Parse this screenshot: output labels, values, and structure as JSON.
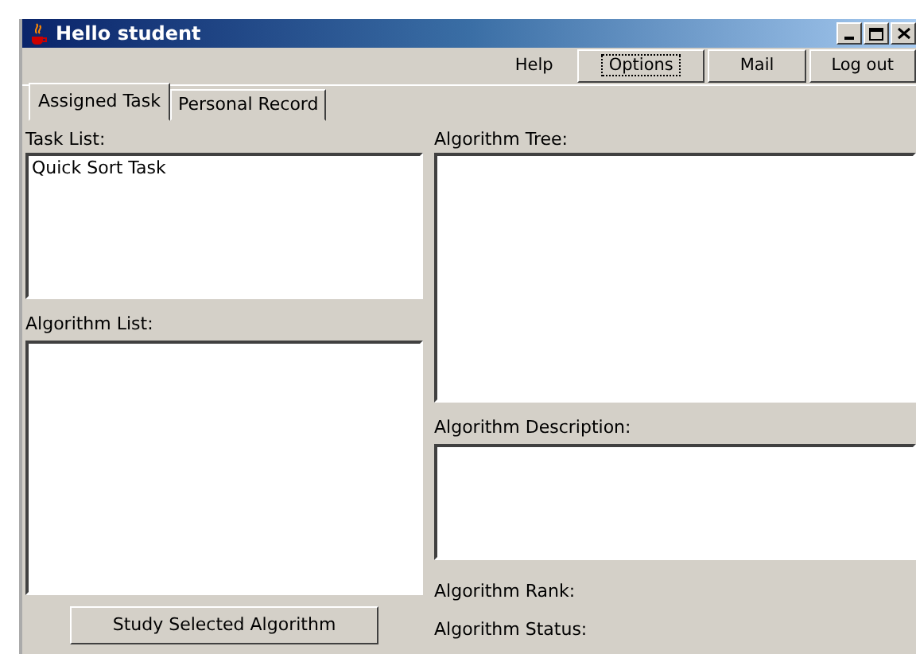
{
  "window": {
    "title": "Hello student"
  },
  "menu": [
    {
      "label": "Help",
      "kind": "flat",
      "focused": false
    },
    {
      "label": "Options",
      "kind": "button",
      "focused": true
    },
    {
      "label": "Mail",
      "kind": "button",
      "focused": false
    },
    {
      "label": "Log out",
      "kind": "button",
      "focused": false
    }
  ],
  "tabs": [
    {
      "label": "Assigned Task",
      "selected": true
    },
    {
      "label": "Personal Record",
      "selected": false
    }
  ],
  "task_list": {
    "label": "Task List:",
    "items": [
      "Quick Sort Task"
    ]
  },
  "algorithm_list": {
    "label": "Algorithm List:"
  },
  "study_button": "Study Selected Algorithm",
  "algorithm_tree": {
    "label": "Algorithm Tree:"
  },
  "algorithm_description": {
    "label": "Algorithm Description:"
  },
  "algorithm_rank": {
    "label": "Algorithm Rank:"
  },
  "algorithm_status": {
    "label": "Algorithm Status:"
  }
}
